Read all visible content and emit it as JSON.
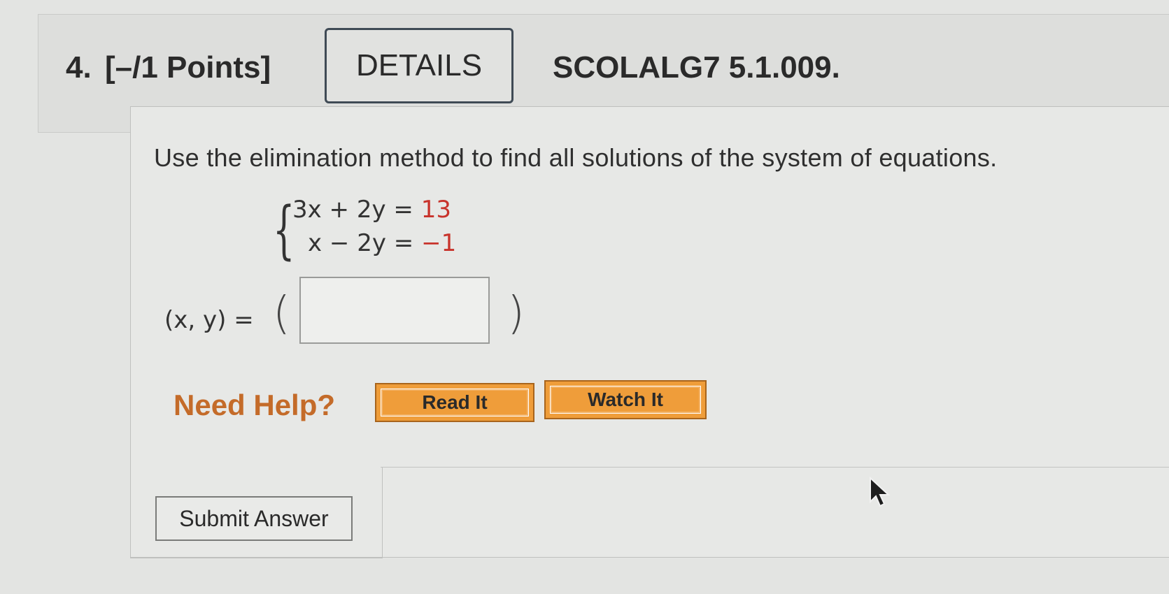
{
  "question": {
    "number": "4.",
    "points": "[–/1 Points]",
    "details_label": "DETAILS",
    "code": "SCOLALG7 5.1.009."
  },
  "prompt": "Use the elimination method to find all solutions of the system of equations.",
  "system": {
    "eq1_lhs": "3x + 2y =",
    "eq1_rhs": "13",
    "eq2_lhs": "x − 2y =",
    "eq2_rhs": "−1"
  },
  "answer": {
    "label": "(x, y) =",
    "value": ""
  },
  "help": {
    "label": "Need Help?",
    "read_it": "Read It",
    "watch_it": "Watch It"
  },
  "submit_label": "Submit Answer",
  "colors": {
    "help_text": "#c46b29",
    "help_button": "#ef9d3a",
    "rhs_value": "#c8332b"
  },
  "icons": [
    "cursor-arrow-icon"
  ]
}
